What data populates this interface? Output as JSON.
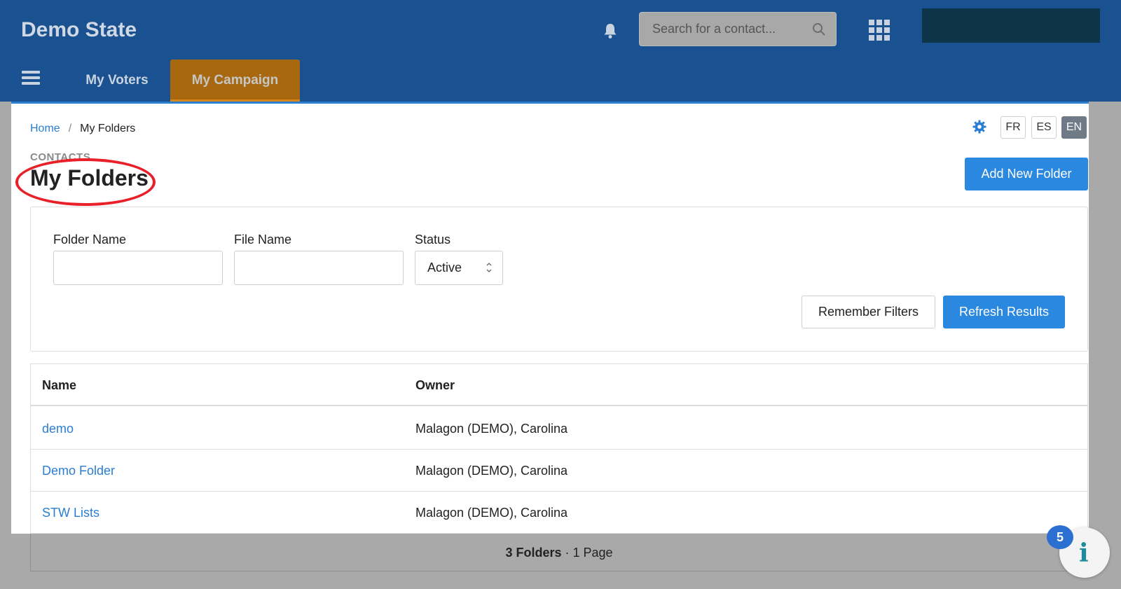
{
  "header": {
    "brand": "Demo State",
    "search_placeholder": "Search for a contact...",
    "nav": {
      "my_voters": "My Voters",
      "my_campaign": "My Campaign"
    }
  },
  "breadcrumb": {
    "home": "Home",
    "separator": "/",
    "current": "My Folders"
  },
  "languages": [
    "FR",
    "ES",
    "EN"
  ],
  "selected_language": "EN",
  "page": {
    "overline": "CONTACTS",
    "title": "My Folders",
    "add_button": "Add New Folder"
  },
  "filters": {
    "folder_name_label": "Folder Name",
    "folder_name_value": "",
    "file_name_label": "File Name",
    "file_name_value": "",
    "status_label": "Status",
    "status_value": "Active",
    "remember_button": "Remember Filters",
    "refresh_button": "Refresh Results"
  },
  "table": {
    "columns": [
      "Name",
      "Owner"
    ],
    "rows": [
      {
        "name": "demo",
        "owner": "Malagon (DEMO), Carolina"
      },
      {
        "name": "Demo Folder",
        "owner": "Malagon (DEMO), Carolina"
      },
      {
        "name": "STW Lists",
        "owner": "Malagon (DEMO), Carolina"
      }
    ],
    "footer_count": "3 Folders",
    "footer_sep": " · ",
    "footer_pages": "1 Page"
  },
  "help_badge": "5",
  "help_icon": "i",
  "colors": {
    "header_bg": "#1a5190",
    "active_tab": "#a76810",
    "primary": "#2b88e0",
    "link": "#2a7ed2",
    "annotation_circle": "#e8202a"
  }
}
